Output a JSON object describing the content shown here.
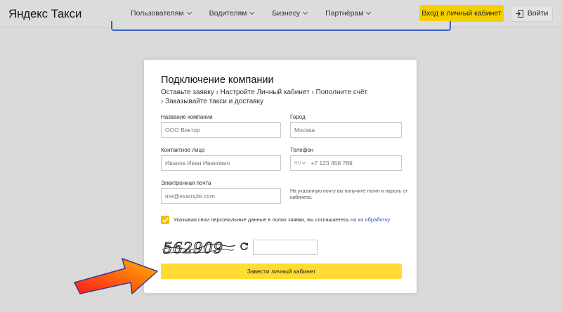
{
  "header": {
    "logo_brand": "Яндекс",
    "logo_product": "Такси",
    "nav": [
      {
        "label": "Пользователям"
      },
      {
        "label": "Водителям"
      },
      {
        "label": "Бизнесу"
      },
      {
        "label": "Партнёрам"
      }
    ],
    "cabinet_label": "Вход в личный кабинет",
    "login_label": "Войти"
  },
  "form": {
    "title": "Подключение компании",
    "steps": "Оставьте заявку  ›  Настройте Личный кабинет  ›  Пополните счёт  ›  Заказывайте такси и доставку",
    "company": {
      "label": "Название компании",
      "placeholder": "ООО Вектор"
    },
    "city": {
      "label": "Город",
      "placeholder": "Москва"
    },
    "contact": {
      "label": "Контактное лицо",
      "placeholder": "Иванов Иван Иванович"
    },
    "phone": {
      "label": "Телефон",
      "prefix": "RU",
      "placeholder": "+7 123 456 789"
    },
    "email": {
      "label": "Электронная почта",
      "placeholder": "me@example.com"
    },
    "email_hint": "На указанную почту вы получите логин и пароль от кабинета.",
    "consent_text": "Указывая свои персональные данные в полях заявки, вы соглашаетесь ",
    "consent_link": "на их обработку",
    "captcha_text": "562909",
    "submit_label": "Завести личный кабинет"
  },
  "colors": {
    "accent_yellow": "#f5d000",
    "link_blue": "#2b44b8",
    "arrow_start": "#ff1a1a",
    "arrow_end": "#ffb300"
  }
}
